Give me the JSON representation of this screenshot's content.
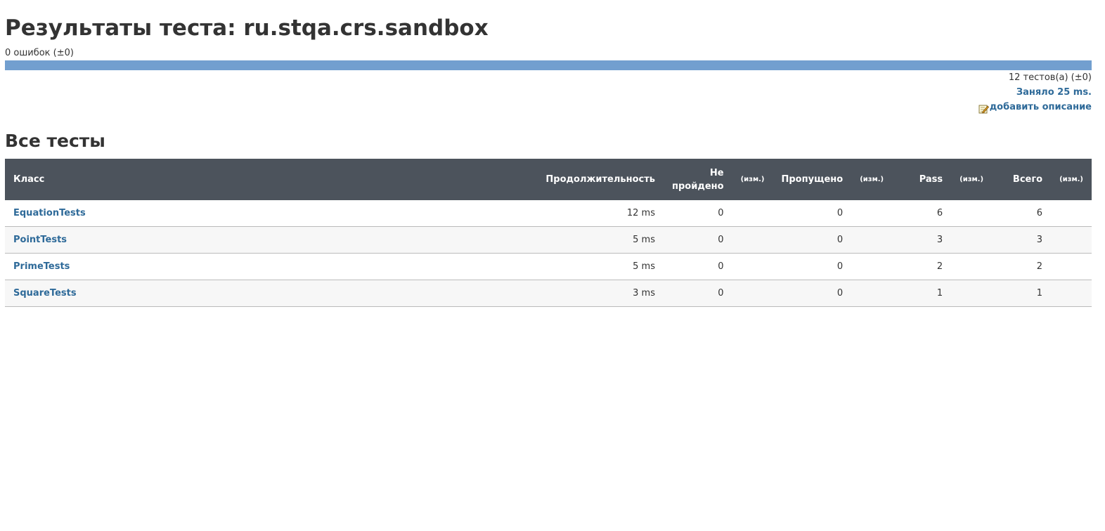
{
  "title": "Результаты теста: ru.stqa.crs.sandbox",
  "fail_summary": "0 ошибок (±0)",
  "pass_fraction": 1.0,
  "colors": {
    "progress_bar": "#729fcf",
    "header_bg": "#4c535c",
    "link": "#2e6a99"
  },
  "tests_count": "12 тестов(а) (±0)",
  "duration": "Заняло 25 ms.",
  "add_description": "добавить описание",
  "edit_icon": "edit-icon",
  "section_title": "Все тесты",
  "table": {
    "headers": {
      "class": "Класс",
      "duration": "Продолжительность",
      "failed_1": "Не",
      "failed_2": "пройдено",
      "delta": "(изм.)",
      "skipped": "Пропущено",
      "pass": "Pass",
      "total": "Всего"
    },
    "rows": [
      {
        "name": "EquationTests",
        "duration": "12 ms",
        "failed": "0",
        "skipped": "0",
        "pass": "6",
        "total": "6"
      },
      {
        "name": "PointTests",
        "duration": "5 ms",
        "failed": "0",
        "skipped": "0",
        "pass": "3",
        "total": "3"
      },
      {
        "name": "PrimeTests",
        "duration": "5 ms",
        "failed": "0",
        "skipped": "0",
        "pass": "2",
        "total": "2"
      },
      {
        "name": "SquareTests",
        "duration": "3 ms",
        "failed": "0",
        "skipped": "0",
        "pass": "1",
        "total": "1"
      }
    ]
  }
}
